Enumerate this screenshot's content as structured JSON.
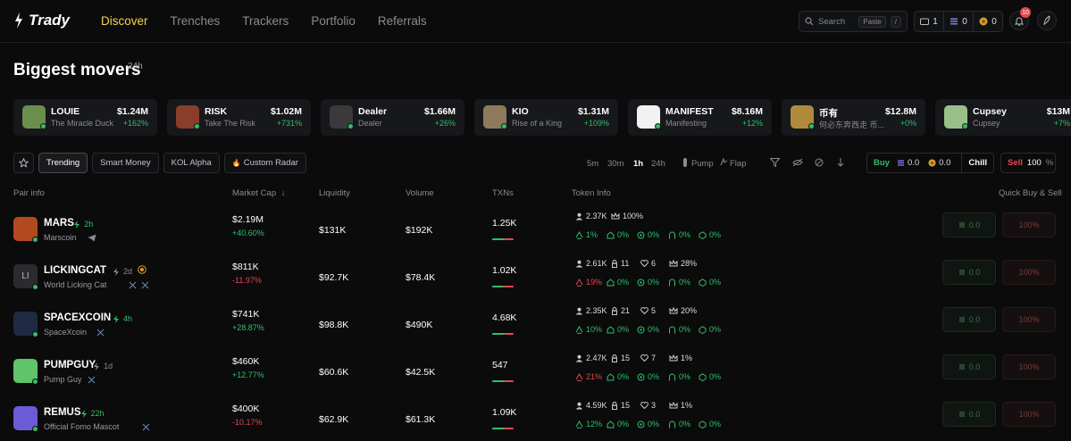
{
  "app": {
    "name": "Trady"
  },
  "nav": [
    {
      "label": "Discover",
      "active": true
    },
    {
      "label": "Trenches",
      "active": false
    },
    {
      "label": "Trackers",
      "active": false
    },
    {
      "label": "Portfolio",
      "active": false
    },
    {
      "label": "Referrals",
      "active": false
    }
  ],
  "search": {
    "placeholder": "Search",
    "paste": "Paste",
    "shortcut": "/"
  },
  "wallet": {
    "folder_count": "1",
    "sol_balance": "0",
    "coin_balance": "0"
  },
  "notifications": {
    "count": "10"
  },
  "movers": {
    "title": "Biggest movers",
    "period": "24h",
    "items": [
      {
        "symbol": "LOUIE",
        "name": "The Miracle Duck",
        "price": "$1.24M",
        "change": "+162%",
        "color": "#6a8f4a"
      },
      {
        "symbol": "RISK",
        "name": "Take The Risk",
        "price": "$1.02M",
        "change": "+731%",
        "color": "#8a3d2a"
      },
      {
        "symbol": "Dealer",
        "name": "Dealer",
        "price": "$1.66M",
        "change": "+26%",
        "color": "#3a3a3a"
      },
      {
        "symbol": "KIO",
        "name": "Rise of a King",
        "price": "$1.31M",
        "change": "+109%",
        "color": "#8d7a5a"
      },
      {
        "symbol": "MANIFEST",
        "name": "Manifesting",
        "price": "$8.16M",
        "change": "+12%",
        "color": "#f2f2f2"
      },
      {
        "symbol": "币有",
        "name": "何必东奔西走 币...",
        "price": "$12.8M",
        "change": "+0%",
        "color": "#b08a3c"
      },
      {
        "symbol": "Cupsey",
        "name": "Cupsey",
        "price": "$13M",
        "change": "+7%",
        "color": "#9ac08a"
      }
    ]
  },
  "filters": {
    "tabs": [
      {
        "label": "Trending",
        "active": true
      },
      {
        "label": "Smart Money",
        "active": false
      },
      {
        "label": "KOL Alpha",
        "active": false
      },
      {
        "label": "Custom Radar",
        "active": false
      }
    ],
    "timeframes": [
      {
        "label": "5m",
        "active": false
      },
      {
        "label": "30m",
        "active": false
      },
      {
        "label": "1h",
        "active": true
      },
      {
        "label": "24h",
        "active": false
      }
    ],
    "sources": [
      "Pump",
      "Flap"
    ],
    "buy": {
      "label": "Buy",
      "sol": "0.0",
      "coin": "0.0",
      "mode": "Chill"
    },
    "sell": {
      "label": "Sell",
      "value": "100",
      "unit": "%"
    }
  },
  "table": {
    "headers": {
      "pair": "Pair info",
      "mcap": "Market Cap",
      "liquidity": "Liquidity",
      "volume": "Volume",
      "txns": "TXNs",
      "token": "Token Info",
      "quick": "Quick Buy & Sell"
    },
    "rows": [
      {
        "symbol": "MARS",
        "age": "2h",
        "age_hot": true,
        "name": "Marscoin",
        "mcap": "$2.19M",
        "mchg": "+40.60%",
        "up": true,
        "liq": "$131K",
        "vol": "$192K",
        "txns": "1.25K",
        "buy_ratio": 0.55,
        "holders": "2.37K",
        "dev": "",
        "snipers": "",
        "top": "100%",
        "s1": "1%",
        "s1_red": false,
        "s2": "0%",
        "s3": "0%",
        "s4": "0%",
        "s5": "0%",
        "qbuy": "0.0",
        "qsell": "100%",
        "color": "#b34a1f"
      },
      {
        "symbol": "LICKINGCAT",
        "age": "2d",
        "age_hot": false,
        "name": "World Licking Cat",
        "mcap": "$811K",
        "mchg": "-11.97%",
        "up": false,
        "liq": "$92.7K",
        "vol": "$78.4K",
        "txns": "1.02K",
        "buy_ratio": 0.5,
        "holders": "2.61K",
        "dev": "11",
        "snipers": "6",
        "top": "28%",
        "s1": "19%",
        "s1_red": true,
        "s2": "0%",
        "s3": "0%",
        "s4": "0%",
        "s5": "0%",
        "qbuy": "0.0",
        "qsell": "100%",
        "color": "#2a2b2f",
        "initials": "LI"
      },
      {
        "symbol": "SPACEXCOIN",
        "age": "4h",
        "age_hot": true,
        "name": "SpaceXcoin",
        "mcap": "$741K",
        "mchg": "+28.87%",
        "up": true,
        "liq": "$98.8K",
        "vol": "$490K",
        "txns": "4.68K",
        "buy_ratio": 0.6,
        "holders": "2.35K",
        "dev": "21",
        "snipers": "5",
        "top": "20%",
        "s1": "10%",
        "s1_red": false,
        "s2": "0%",
        "s3": "0%",
        "s4": "0%",
        "s5": "0%",
        "qbuy": "0.0",
        "qsell": "100%",
        "color": "#1f2a44"
      },
      {
        "symbol": "PUMPGUY",
        "age": "1d",
        "age_hot": false,
        "name": "Pump Guy",
        "mcap": "$460K",
        "mchg": "+12.77%",
        "up": true,
        "liq": "$60.6K",
        "vol": "$42.5K",
        "txns": "547",
        "buy_ratio": 0.55,
        "holders": "2.47K",
        "dev": "15",
        "snipers": "7",
        "top": "1%",
        "s1": "21%",
        "s1_red": true,
        "s2": "0%",
        "s3": "0%",
        "s4": "0%",
        "s5": "0%",
        "qbuy": "0.0",
        "qsell": "100%",
        "color": "#5fc46a"
      },
      {
        "symbol": "REMUS",
        "age": "22h",
        "age_hot": true,
        "name": "Official Fomo Mascot",
        "mcap": "$400K",
        "mchg": "-10.17%",
        "up": false,
        "liq": "$62.9K",
        "vol": "$61.3K",
        "txns": "1.09K",
        "buy_ratio": 0.55,
        "holders": "4.59K",
        "dev": "15",
        "snipers": "3",
        "top": "1%",
        "s1": "12%",
        "s1_red": false,
        "s2": "0%",
        "s3": "0%",
        "s4": "0%",
        "s5": "0%",
        "qbuy": "0.0",
        "qsell": "100%",
        "color": "#6b5bd6"
      }
    ]
  },
  "colors": {
    "accent": "#f5d24a",
    "green": "#2fbf6a",
    "red": "#e5484d",
    "bg": "#0b0b0c"
  }
}
